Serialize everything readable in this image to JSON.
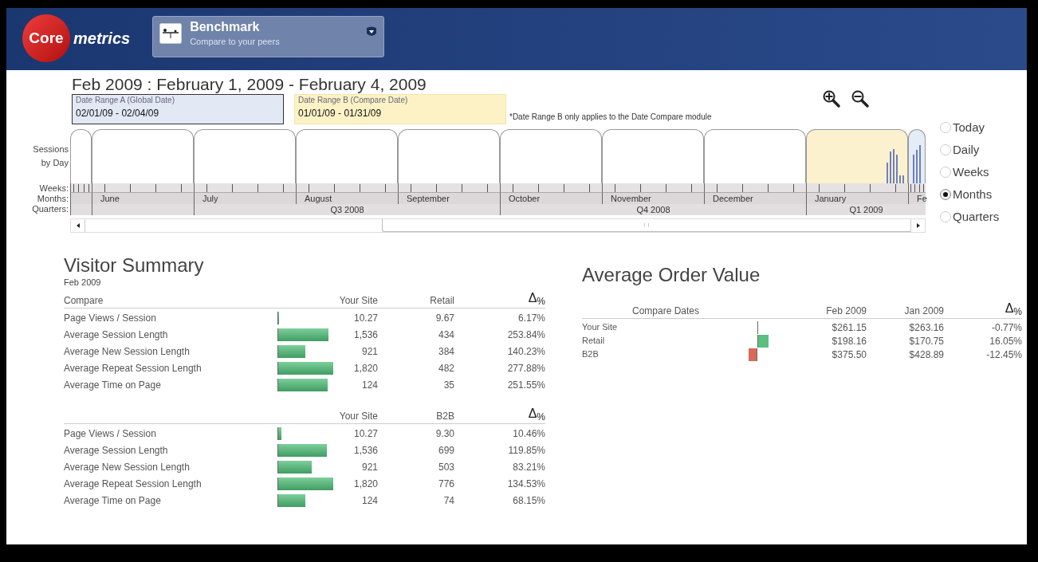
{
  "header": {
    "logo": {
      "part_1": "Core",
      "part_2": "metrics"
    },
    "module": {
      "title": "Benchmark",
      "subtitle": "Compare to your peers"
    }
  },
  "date_title": "Feb 2009 : February 1, 2009 - February 4, 2009",
  "date_ranges": [
    {
      "kind": "global",
      "label": "Date Range A (Global Date)",
      "value": "02/01/09 - 02/04/09"
    },
    {
      "kind": "compare",
      "label": "Date Range B (Compare Date)",
      "value": "01/01/09 - 01/31/09"
    }
  ],
  "date_note": "*Date Range B only applies to the Date Compare module",
  "timeline": {
    "chart_label": "Sessions by Day",
    "row_labels": [
      "Weeks:",
      "Months:",
      "Quarters:"
    ],
    "quarters": [
      {
        "months": [
          {
            "label": "June",
            "in_range_a": false,
            "in_range_b": false
          }
        ]
      },
      {
        "label": "Q3 2008",
        "months": [
          {
            "label": "July",
            "in_range_a": false,
            "in_range_b": false
          },
          {
            "label": "August",
            "in_range_a": false,
            "in_range_b": false
          },
          {
            "label": "September",
            "in_range_a": false,
            "in_range_b": false
          }
        ]
      },
      {
        "label": "Q4 2008",
        "months": [
          {
            "label": "October",
            "in_range_a": false,
            "in_range_b": false
          },
          {
            "label": "November",
            "in_range_a": false,
            "in_range_b": false
          },
          {
            "label": "December",
            "in_range_a": false,
            "in_range_b": false
          }
        ]
      },
      {
        "label": "Q1 2009",
        "months": [
          {
            "label": "January",
            "in_range_a": false,
            "in_range_b": true
          },
          {
            "label": "Fe",
            "in_range_a": true,
            "in_range_b": false
          }
        ]
      }
    ]
  },
  "granularity": [
    {
      "label": "Today",
      "selected": false
    },
    {
      "label": "Daily",
      "selected": false
    },
    {
      "label": "Weeks",
      "selected": false
    },
    {
      "label": "Months",
      "selected": true
    },
    {
      "label": "Quarters",
      "selected": false
    }
  ],
  "visitor_summary": {
    "title": "Visitor Summary",
    "subtitle": "Feb 2009",
    "tables": [
      {
        "columns": [
          "Compare",
          "Your Site",
          "Retail",
          "Δ$_{%}$"
        ],
        "rows": [
          {
            "label": "Page Views / Session",
            "your_site": "10.27",
            "peer": "9.67",
            "delta": "6.17%"
          },
          {
            "label": "Average Session Length",
            "your_site": "1,536",
            "peer": "434",
            "delta": "253.84%"
          },
          {
            "label": "Average New Session Length",
            "your_site": "921",
            "peer": "384",
            "delta": "140.23%"
          },
          {
            "label": "Average Repeat Session Length",
            "your_site": "1,820",
            "peer": "482",
            "delta": "277.88%"
          },
          {
            "label": "Average Time on Page",
            "your_site": "124",
            "peer": "35",
            "delta": "251.55%"
          }
        ]
      },
      {
        "columns": [
          "Your Site",
          "B2B",
          "Δ$_{%}$"
        ],
        "rows": [
          {
            "label": "Page Views / Session",
            "your_site": "10.27",
            "peer": "9.30",
            "delta": "10.46%"
          },
          {
            "label": "Average Session Length",
            "your_site": "1,536",
            "peer": "699",
            "delta": "119.85%"
          },
          {
            "label": "Average New Session Length",
            "your_site": "921",
            "peer": "503",
            "delta": "83.21%"
          },
          {
            "label": "Average Repeat Session Length",
            "your_site": "1,820",
            "peer": "776",
            "delta": "134.53%"
          },
          {
            "label": "Average Time on Page",
            "your_site": "124",
            "peer": "74",
            "delta": "68.15%"
          }
        ]
      }
    ]
  },
  "average_order_value": {
    "title": "Average Order Value",
    "columns": [
      "Compare Dates",
      "Feb 2009",
      "Jan 2009",
      "Δ$_{%}$"
    ],
    "rows": [
      {
        "label": "Your Site",
        "current": "$261.15",
        "previous": "$263.16",
        "delta": "-0.77%"
      },
      {
        "label": "Retail",
        "current": "$198.16",
        "previous": "$170.75",
        "delta": "16.05%"
      },
      {
        "label": "B2B",
        "current": "$375.50",
        "previous": "$428.89",
        "delta": "-12.45%"
      }
    ]
  }
}
